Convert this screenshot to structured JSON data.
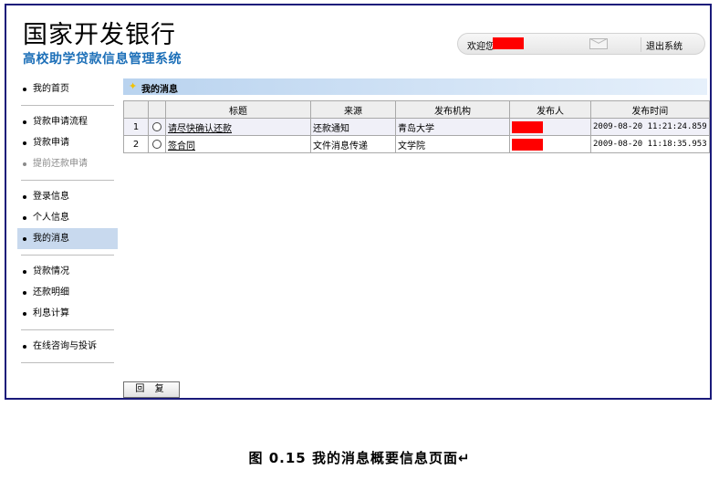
{
  "header": {
    "brand_title": "国家开发银行",
    "brand_subtitle": "高校助学贷款信息管理系统",
    "welcome": "欢迎您",
    "logout_label": "退出系统"
  },
  "sidebar": {
    "groups": [
      [
        {
          "label": "我的首页",
          "state": "normal"
        }
      ],
      [
        {
          "label": "贷款申请流程",
          "state": "normal"
        },
        {
          "label": "贷款申请",
          "state": "normal"
        },
        {
          "label": "提前还款申请",
          "state": "disabled"
        }
      ],
      [
        {
          "label": "登录信息",
          "state": "normal"
        },
        {
          "label": "个人信息",
          "state": "normal"
        },
        {
          "label": "我的消息",
          "state": "active"
        }
      ],
      [
        {
          "label": "贷款情况",
          "state": "normal"
        },
        {
          "label": "还款明细",
          "state": "normal"
        },
        {
          "label": "利息计算",
          "state": "normal"
        }
      ],
      [
        {
          "label": "在线咨询与投诉",
          "state": "normal"
        }
      ]
    ]
  },
  "messages": {
    "section_title": "我的消息",
    "columns": [
      "标题",
      "来源",
      "发布机构",
      "发布人",
      "发布时间"
    ],
    "rows": [
      {
        "num": "1",
        "title": "请尽快确认还款",
        "source": "还款通知",
        "org": "青岛大学",
        "publisher_redacted": true,
        "time": "2009-08-20 11:21:24.859"
      },
      {
        "num": "2",
        "title": "签合同",
        "source": "文件消息传递",
        "org": "文学院",
        "publisher_redacted": true,
        "time": "2009-08-20 11:18:35.953"
      }
    ],
    "reply_label": "回 复"
  },
  "caption": "图 0.15   我的消息概要信息页面↵",
  "colors": {
    "frame_border": "#1a1a7a",
    "brand_subtitle": "#1c6fb8",
    "active_nav": "#c8d9ee",
    "redaction": "#ff0000"
  }
}
